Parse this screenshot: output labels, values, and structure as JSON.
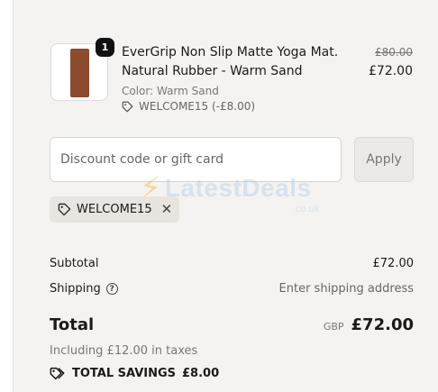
{
  "product": {
    "name": "EverGrip Non Slip Matte Yoga Mat. Natural Rubber - Warm Sand",
    "variant": "Color: Warm Sand",
    "discount_applied": "WELCOME15 (-£8.00)",
    "price_original": "£80.00",
    "price_current": "£72.00",
    "quantity": "1",
    "thumb_color": "#8a4c2d"
  },
  "discount": {
    "placeholder": "Discount code or gift card",
    "apply_label": "Apply",
    "active_code": "WELCOME15"
  },
  "watermark": {
    "brand": "LatestDeals",
    "domain": ".co.uk"
  },
  "summary": {
    "subtotal_label": "Subtotal",
    "subtotal_value": "£72.00",
    "shipping_label": "Shipping",
    "shipping_value": "Enter shipping address",
    "total_label": "Total",
    "currency": "GBP",
    "total_value": "£72.00",
    "taxes_note": "Including £12.00 in taxes",
    "savings_label": "TOTAL SAVINGS",
    "savings_value": "£8.00"
  },
  "icons": {
    "tag": "tag-icon",
    "close": "close-icon",
    "help": "help-circle-icon",
    "savings": "double-tag-icon"
  }
}
